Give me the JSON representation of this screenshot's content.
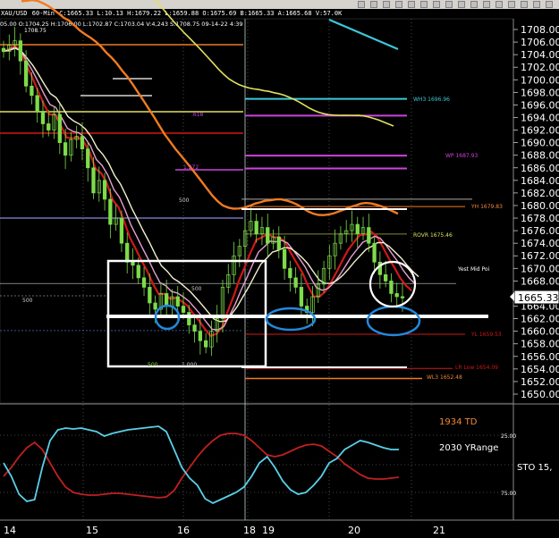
{
  "toolbar": {
    "button_count": 16
  },
  "header": {
    "symbol": "XAU/USD",
    "interval": "60-Min",
    "quote": "C:1665.33  L:10.13  H:1679.22  L:1659.88  O:1675.69  B:1665.33  A:1665.68  V:57.0K",
    "ohlc_line": "05.00  O:1704.25  H:1706.00  L:1702.87  C:1703.04  V:4,243  S:1708.75  09-14-22  4:39"
  },
  "price_axis": {
    "ticks": [
      "1708.00",
      "1706.00",
      "1704.00",
      "1702.00",
      "1700.00",
      "1698.00",
      "1696.00",
      "1694.00",
      "1692.00",
      "1690.00",
      "1688.00",
      "1686.00",
      "1684.00",
      "1682.00",
      "1680.00",
      "1678.00",
      "1676.00",
      "1674.00",
      "1672.00",
      "1670.00",
      "1668.00",
      "1666.00",
      "1664.00",
      "1662.00",
      "1660.00",
      "1658.00",
      "1656.00",
      "1654.00",
      "1652.00",
      "1650.00"
    ],
    "current_price": "1665.33"
  },
  "time_axis": {
    "ticks": [
      "14",
      "15",
      "16",
      "18",
      "19",
      "20",
      "21"
    ]
  },
  "level_labels": {
    "wh3": "WH3 1696.96",
    "wp": "WP 1687.93",
    "yh": "YH 1679.83",
    "rovr": "ROVR 1675.46",
    "yest_mid": "Yest Mid Poi",
    "yl": "YL 1659.53",
    "lr_low": "LR Low 1654.09",
    "wl3": "WL3 1652.48",
    "fib_618": ".618",
    "fib_1272": "1.272",
    "fib_500_a": "500",
    "fib_500_b": "500",
    "fib_500_c": "500",
    "peak": "1708.75",
    "fib_bottom_a": "500",
    "fib_bottom_b": "1.000"
  },
  "oscillator": {
    "label_td": "1934 TD",
    "label_yrange": "2030 YRange",
    "label_sto": "STO  15,",
    "tick_25": "25.00",
    "tick_75": "75.00"
  },
  "colors": {
    "background": "#000000",
    "candle": "#7ddc4a",
    "ema_red": "#d01818",
    "ema_pink": "#e6a0d0",
    "ema_white": "#f4f0d0",
    "ma_orange": "#f07b22",
    "ma_yellow": "#e0e060",
    "ma_cyan": "#3cc8d8",
    "sto_fast": "#5ad0e8",
    "sto_slow": "#c02020",
    "annot_blue": "#2288dd",
    "label_orange": "#f08838"
  },
  "chart_data": [
    {
      "type": "candlestick",
      "title": "",
      "symbol": "XAU/USD",
      "interval": "60-Min",
      "x_ticks": [
        "14",
        "15",
        "16",
        "18",
        "19",
        "20",
        "21"
      ],
      "ylim": [
        1649,
        1709
      ],
      "closes": [
        1704.5,
        1705.5,
        1706.2,
        1703,
        1699,
        1697.5,
        1695,
        1693,
        1692,
        1694.5,
        1690,
        1688,
        1690.5,
        1691,
        1689,
        1686,
        1682,
        1684,
        1681,
        1677,
        1678,
        1674,
        1671,
        1670.5,
        1668.5,
        1667,
        1664.5,
        1663.5,
        1666,
        1664,
        1665.5,
        1664,
        1663,
        1661,
        1660,
        1658.5,
        1657.5,
        1660,
        1662,
        1667,
        1669,
        1672,
        1673.5,
        1676,
        1677.5,
        1675.5,
        1676.5,
        1674,
        1675,
        1673,
        1670,
        1668.5,
        1667,
        1664,
        1663,
        1665.5,
        1667.5,
        1670,
        1672,
        1674,
        1675.5,
        1676,
        1677,
        1675.5,
        1676.5,
        1674,
        1671,
        1669,
        1668,
        1666,
        1665.5,
        1665.3
      ],
      "levels": [
        {
          "name": "WH3",
          "value": 1696.96
        },
        {
          "name": "WP",
          "value": 1687.93
        },
        {
          "name": "YH",
          "value": 1679.83
        },
        {
          "name": "ROVR",
          "value": 1675.46
        },
        {
          "name": "YL",
          "value": 1659.53
        },
        {
          "name": "LR Low",
          "value": 1654.09
        },
        {
          "name": "WL3",
          "value": 1652.48
        }
      ],
      "current_price": 1665.33
    },
    {
      "type": "line",
      "title": "",
      "indicator": "STO 15",
      "y_ticks": [
        "25.00",
        "75.00"
      ],
      "series": [
        {
          "values": [
            55,
            40,
            20,
            12,
            14,
            50,
            80,
            92,
            94,
            93,
            94,
            92,
            90,
            85,
            88,
            90,
            92,
            93,
            94,
            95,
            96,
            90,
            70,
            50,
            38,
            30,
            15,
            10,
            14,
            18,
            22,
            28,
            40,
            55,
            62,
            50,
            35,
            25,
            20,
            22,
            30,
            40,
            55,
            60,
            70,
            75,
            80,
            78,
            75,
            72,
            70,
            70
          ]
        },
        {
          "values": [
            70,
            60,
            48,
            38,
            32,
            40,
            55,
            70,
            82,
            88,
            90,
            91,
            91,
            90,
            89,
            89,
            90,
            91,
            92,
            93,
            94,
            93,
            86,
            72,
            60,
            48,
            38,
            30,
            24,
            22,
            22,
            24,
            30,
            38,
            46,
            48,
            46,
            42,
            38,
            35,
            34,
            36,
            42,
            48,
            56,
            62,
            68,
            72,
            73,
            73,
            72,
            71
          ]
        }
      ]
    }
  ]
}
